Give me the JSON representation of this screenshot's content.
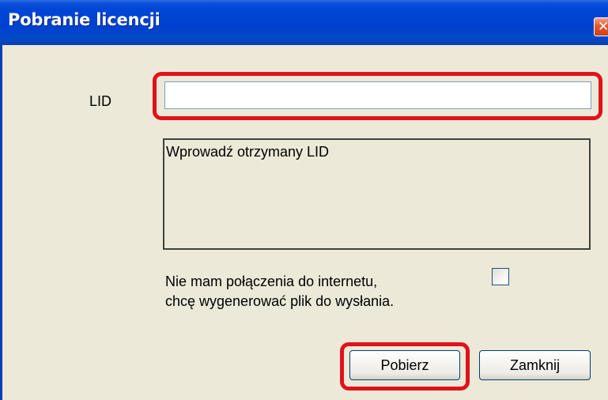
{
  "window": {
    "title": "Pobranie licencji",
    "close_glyph": "✕"
  },
  "form": {
    "lid_label": "LID",
    "lid_value": "",
    "lid_placeholder": "",
    "info_text": "Wprowadź otrzymany LID",
    "offline_line1": "Nie mam połączenia do internetu,",
    "offline_line2": "chcę wygenerować plik do wysłania.",
    "offline_checked": false
  },
  "buttons": {
    "download_label": "Pobierz",
    "close_label": "Zamknij"
  },
  "colors": {
    "titlebar": "#0046d6",
    "highlight": "#e0121b",
    "dialog_bg": "#ece9d8"
  }
}
